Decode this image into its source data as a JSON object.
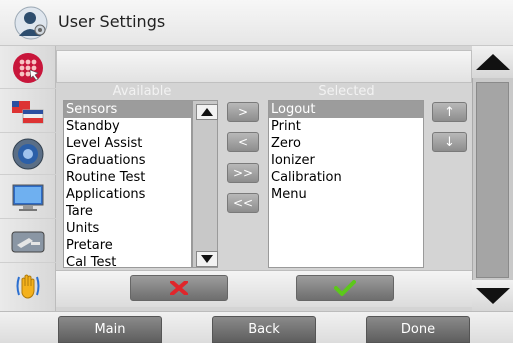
{
  "header": {
    "title": "User Settings",
    "icon": "user-settings-icon"
  },
  "sidebar": {
    "items": [
      {
        "name": "keypad-icon"
      },
      {
        "name": "flags-icon"
      },
      {
        "name": "sound-icon"
      },
      {
        "name": "display-icon"
      },
      {
        "name": "service-icon"
      },
      {
        "name": "hand-icon"
      }
    ]
  },
  "available": {
    "header": "Available",
    "items": [
      "Sensors",
      "Standby",
      "Level Assist",
      "Graduations",
      "Routine Test",
      "Applications",
      "Tare",
      "Units",
      "Pretare",
      "Cal Test"
    ],
    "selected_index": 0
  },
  "selected": {
    "header": "Selected",
    "items": [
      "Logout",
      "Print",
      "Zero",
      "Ionizer",
      "Calibration",
      "Menu"
    ],
    "selected_index": 0
  },
  "transfer": {
    "move_right": ">",
    "move_left": "<",
    "move_all_right": ">>",
    "move_all_left": "<<",
    "move_up": "↑",
    "move_down": "↓"
  },
  "nav": {
    "main": "Main",
    "back": "Back",
    "done": "Done"
  },
  "colors": {
    "cancel": "#e0262b",
    "accept": "#5cc81a",
    "selection": "#9c9c9c"
  }
}
